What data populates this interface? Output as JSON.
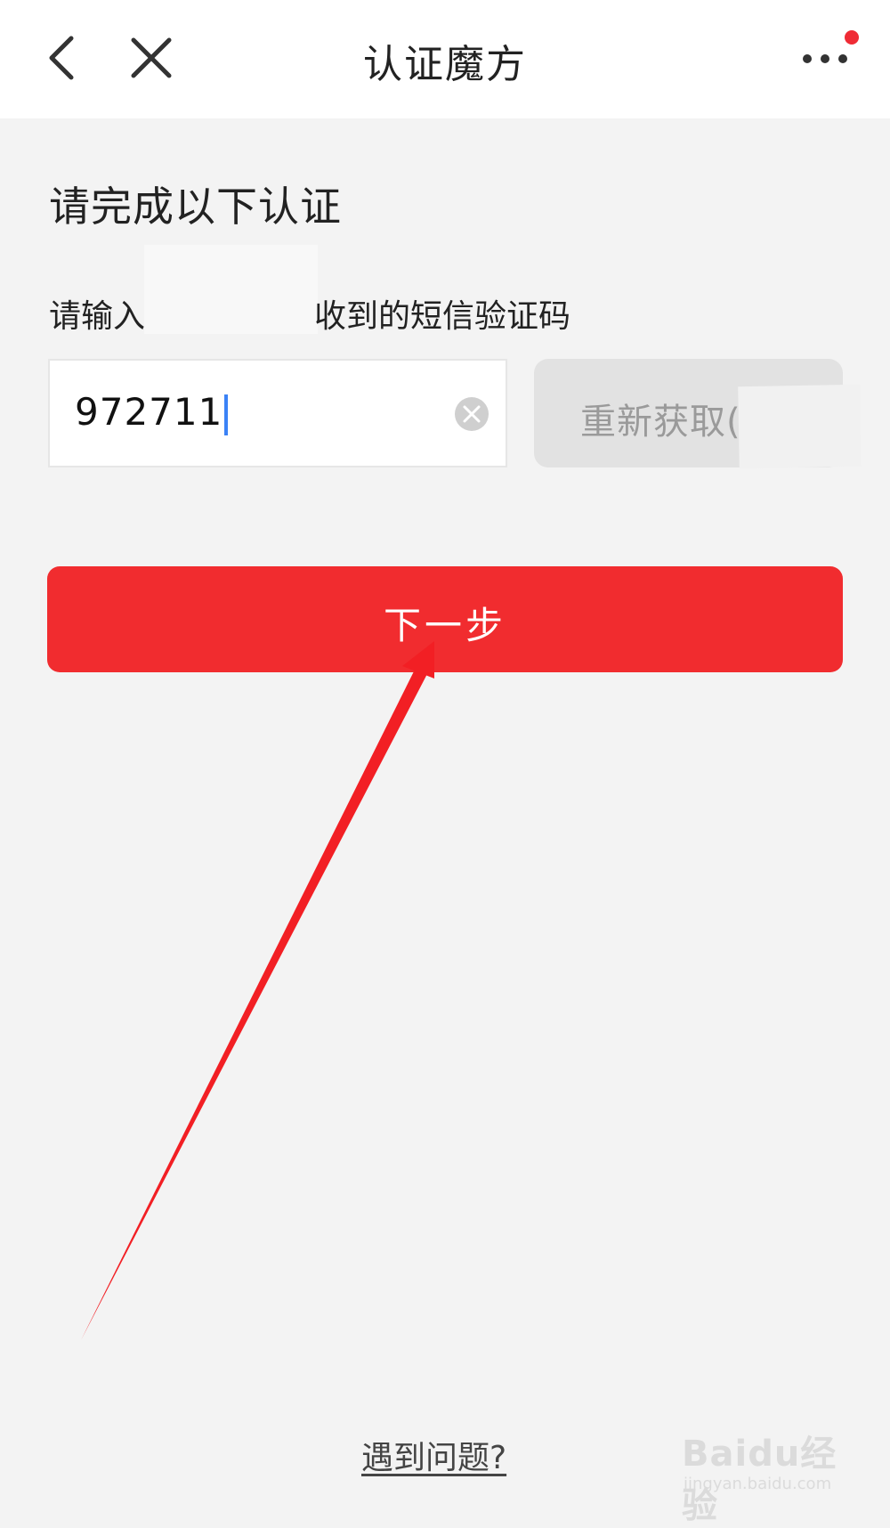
{
  "header": {
    "title": "认证魔方",
    "notification_color": "#ef2b35"
  },
  "form": {
    "section_title": "请完成以下认证",
    "prompt_prefix": "请输入",
    "prompt_suffix": "收到的短信验证码",
    "code_value": "972711",
    "resend_label": "重新获取("
  },
  "actions": {
    "next_label": "下一步",
    "help_link": "遇到问题?"
  },
  "watermark": {
    "brand": "Baidu经验",
    "domain": "jingyan.baidu.com"
  },
  "colors": {
    "accent_red": "#f12c2f",
    "caret_blue": "#3b82f6"
  }
}
